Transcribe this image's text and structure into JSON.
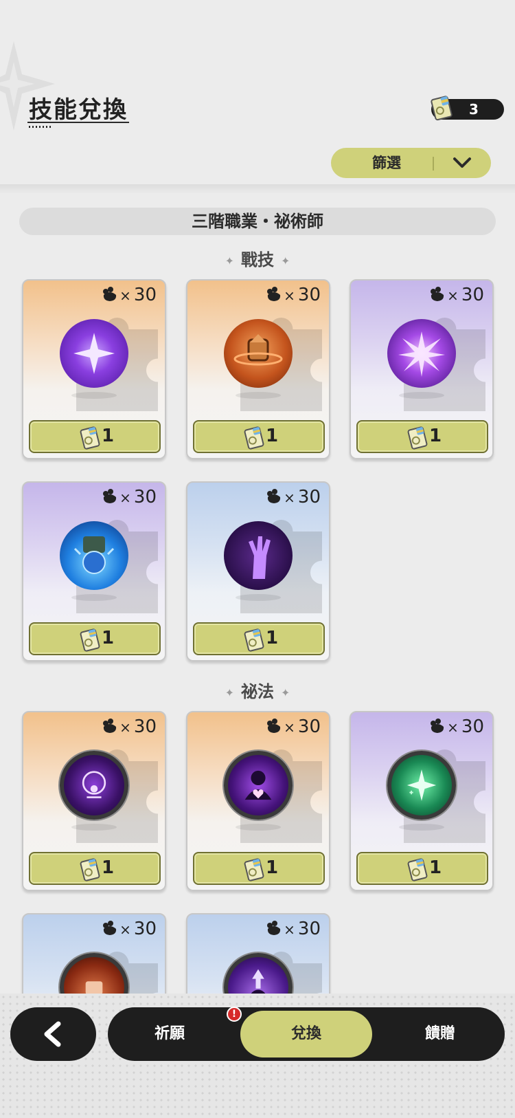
{
  "header": {
    "title": "技能兌換",
    "currency_count": "3",
    "filter_label": "篩選"
  },
  "class_banner": "三階職業・祕術師",
  "sections": [
    {
      "title": "戰技",
      "cards": [
        {
          "theme": "orange",
          "skill_icon": "purple-star-orb-icon",
          "cost": "30",
          "ticket_cost": "1"
        },
        {
          "theme": "orange",
          "skill_icon": "orange-totem-orb-icon",
          "cost": "30",
          "ticket_cost": "1"
        },
        {
          "theme": "purple",
          "skill_icon": "purple-burst-orb-icon",
          "cost": "30",
          "ticket_cost": "1"
        },
        {
          "theme": "purple",
          "skill_icon": "blue-spirit-orb-icon",
          "cost": "30",
          "ticket_cost": "1"
        },
        {
          "theme": "blue",
          "skill_icon": "purple-hand-orb-icon",
          "cost": "30",
          "ticket_cost": "1"
        }
      ]
    },
    {
      "title": "祕法",
      "cards": [
        {
          "theme": "orange",
          "skill_icon": "arcane-eye-orb-icon",
          "cost": "30",
          "ticket_cost": "1"
        },
        {
          "theme": "orange",
          "skill_icon": "arcane-heart-orb-icon",
          "cost": "30",
          "ticket_cost": "1"
        },
        {
          "theme": "purple",
          "skill_icon": "green-sparkle-orb-icon",
          "cost": "30",
          "ticket_cost": "1"
        },
        {
          "theme": "blue",
          "skill_icon": "red-fist-orb-icon",
          "cost": "30",
          "ticket_cost": ""
        },
        {
          "theme": "blue",
          "skill_icon": "purple-rise-orb-icon",
          "cost": "30",
          "ticket_cost": ""
        }
      ]
    }
  ],
  "cost_multiplier": "×",
  "tabs": [
    {
      "label": "祈願",
      "active": false
    },
    {
      "label": "兌換",
      "active": true
    },
    {
      "label": "饋贈",
      "active": false
    }
  ],
  "alert_badge": "!",
  "colors": {
    "accent": "#cfd17a",
    "dark": "#1e1e1e",
    "background": "#ececec",
    "alert": "#d62b2b"
  }
}
